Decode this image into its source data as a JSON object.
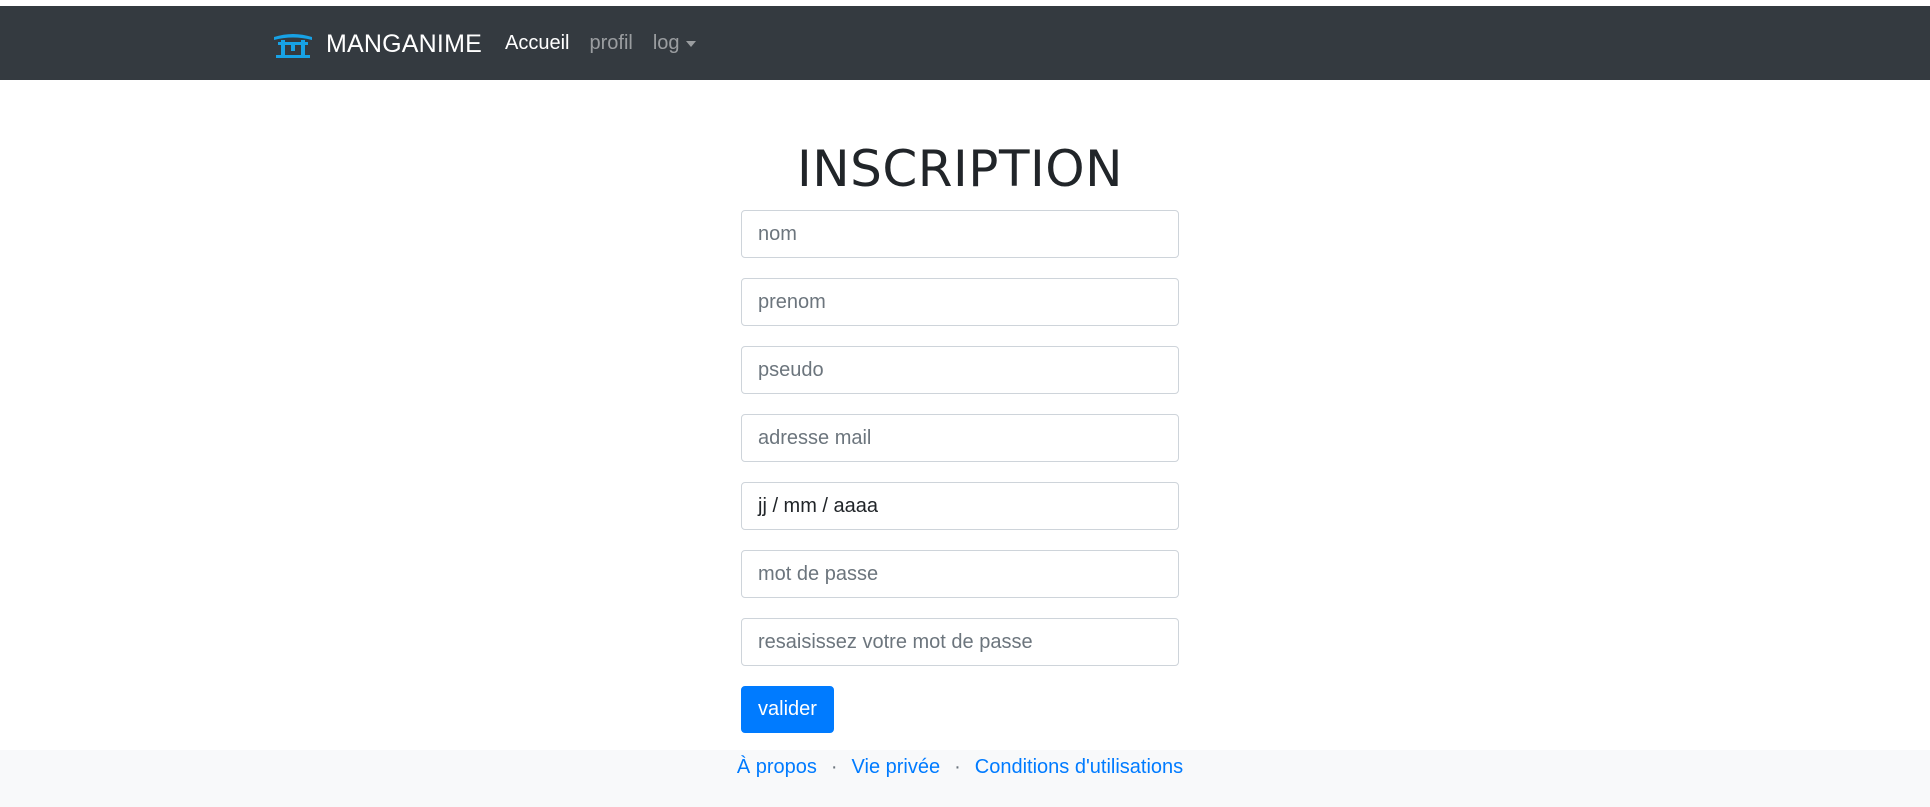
{
  "navbar": {
    "brand": "MANGANIME",
    "brand_icon": "torii-gate-icon",
    "links": [
      {
        "label": "Accueil",
        "active": true
      },
      {
        "label": "profil",
        "active": false
      },
      {
        "label": "log",
        "active": false,
        "dropdown": true
      }
    ]
  },
  "main": {
    "title": "INSCRIPTION",
    "fields": {
      "nom": {
        "placeholder": "nom",
        "value": ""
      },
      "prenom": {
        "placeholder": "prenom",
        "value": ""
      },
      "pseudo": {
        "placeholder": "pseudo",
        "value": ""
      },
      "email": {
        "placeholder": "adresse mail",
        "value": ""
      },
      "birthdate": {
        "display": "jj / mm / aaaa"
      },
      "password": {
        "placeholder": "mot de passe",
        "value": ""
      },
      "password_confirm": {
        "placeholder": "resaisissez votre mot de passe",
        "value": ""
      }
    },
    "submit_label": "valider"
  },
  "footer": {
    "links": [
      "À propos",
      "Vie privée",
      "Conditions d'utilisations"
    ],
    "separator": "·"
  },
  "colors": {
    "navbar_bg": "#343a40",
    "primary": "#007bff",
    "footer_bg": "#f8f9fa",
    "brand_icon": "#17a2e6"
  }
}
